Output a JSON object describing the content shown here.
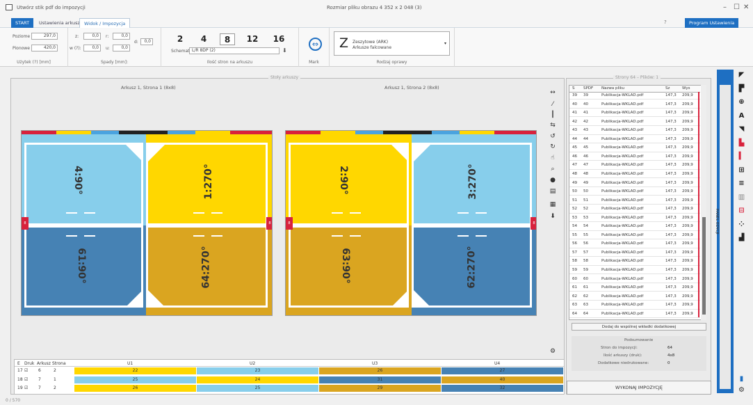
{
  "window": {
    "title": "Utwórz stik pdf do impozycji",
    "image_size_label": "Rozmiar pliku obrazu 4 352 x 2 048 (3)",
    "minimize": "–",
    "maximize": "☐",
    "close": "✕"
  },
  "tabs": [
    {
      "label": "START"
    },
    {
      "label": "Ustawienia arkusza"
    },
    {
      "label": "Widok / Impozycja"
    }
  ],
  "help_icon_label": "?",
  "program_button": "Program Ustawienia",
  "ribbon": {
    "paper": {
      "label_w": "Poziome",
      "val_w": "297,0",
      "label_h": "Pionowe",
      "val_h": "420,0",
      "section": "Użytek (?) [mm]"
    },
    "spady": {
      "z_label": "z:",
      "z_val": "0,0",
      "r_label": "r:",
      "r_val": "0,0",
      "w_label": "w (?):",
      "w_val": "0,0",
      "u_label": "u:",
      "u_val": "0,0",
      "d_label": "d:",
      "d_val": "0,0",
      "section": "Spady [mm]:"
    },
    "counts": {
      "options": [
        "2",
        "4",
        "8",
        "12",
        "16"
      ],
      "selected": "8",
      "schema_label": "Schemat",
      "schema_value": "L/R 8DP (2)",
      "section": "Ilość stron na arkuszu"
    },
    "mark": {
      "section": "Mark"
    },
    "binding": {
      "letter": "Z",
      "line1": "Zeszytowe (ARK)",
      "line2": "Arkusze falcowane",
      "section": "Rodzaj oprawy"
    }
  },
  "workspace": {
    "group_label": "Stoły arkuszy",
    "sheets": [
      {
        "title": "Arkusz 1, Strona 1 (8x8)",
        "pages": [
          {
            "label": "4:90°"
          },
          {
            "label": "1:270°"
          },
          {
            "label": "61:90°"
          },
          {
            "label": "64:270°"
          }
        ]
      },
      {
        "title": "Arkusz 1, Strona 2 (8x8)",
        "pages": [
          {
            "label": "2:90°"
          },
          {
            "label": "3:270°"
          },
          {
            "label": "63:90°"
          },
          {
            "label": "62:270°"
          }
        ]
      }
    ]
  },
  "colors": {
    "accent": "#1e6fc2",
    "yellow": "#ffd700",
    "light_blue": "#87ceeb",
    "steel_blue": "#4682b4",
    "gold": "#daa520",
    "red": "#d8223c"
  },
  "tools": [
    "resize-horizontal-icon",
    "pipette-icon",
    "resize-vertical-icon",
    "swap-icon",
    "rotate-left-icon",
    "rotate-right-icon",
    "hand-icon",
    "zoom-icon",
    "fill-icon",
    "book-icon",
    "calendar-icon",
    "download-icon"
  ],
  "tool_glyphs": [
    "↔",
    "⁄",
    "┃",
    "⇆",
    "↺",
    "↻",
    "☝",
    "⌕",
    "●",
    "▤",
    "▦",
    "⬇"
  ],
  "bottom_table": {
    "headers": [
      "E",
      "Druk",
      "Arkusz",
      "Strona",
      "U1",
      "U2",
      "U3",
      "U4"
    ],
    "rows": [
      {
        "e": "17",
        "druk": "☑",
        "ark": "6",
        "str": "2",
        "u": [
          "22",
          "23",
          "26",
          "27"
        ]
      },
      {
        "e": "18",
        "druk": "☑",
        "ark": "7",
        "str": "1",
        "u": [
          "25",
          "24",
          "31",
          "40"
        ]
      },
      {
        "e": "19",
        "druk": "☑",
        "ark": "7",
        "str": "2",
        "u": [
          "26",
          "25",
          "29",
          "32"
        ]
      }
    ],
    "row_colors": [
      [
        "#ffd700",
        "#87ceeb",
        "#daa520",
        "#4682b4"
      ],
      [
        "#87ceeb",
        "#ffd700",
        "#4682b4",
        "#daa520"
      ],
      [
        "#ffd700",
        "#87ceeb",
        "#daa520",
        "#4682b4"
      ]
    ]
  },
  "right_panel": {
    "group_label": "Strony 64 – Plików: 1",
    "headers": [
      "S",
      "SPDF",
      "Nazwa pliku",
      "Sz",
      "Wys"
    ],
    "rows": [
      [
        "39",
        "39",
        "Publikacja-WKLAD.pdf",
        "147,3",
        "209,9"
      ],
      [
        "40",
        "40",
        "Publikacja-WKLAD.pdf",
        "147,3",
        "209,9"
      ],
      [
        "41",
        "41",
        "Publikacja-WKLAD.pdf",
        "147,3",
        "209,9"
      ],
      [
        "42",
        "42",
        "Publikacja-WKLAD.pdf",
        "147,3",
        "209,9"
      ],
      [
        "43",
        "43",
        "Publikacja-WKLAD.pdf",
        "147,3",
        "209,9"
      ],
      [
        "44",
        "44",
        "Publikacja-WKLAD.pdf",
        "147,3",
        "209,9"
      ],
      [
        "45",
        "45",
        "Publikacja-WKLAD.pdf",
        "147,3",
        "209,9"
      ],
      [
        "46",
        "46",
        "Publikacja-WKLAD.pdf",
        "147,3",
        "209,9"
      ],
      [
        "47",
        "47",
        "Publikacja-WKLAD.pdf",
        "147,3",
        "209,9"
      ],
      [
        "48",
        "48",
        "Publikacja-WKLAD.pdf",
        "147,3",
        "209,9"
      ],
      [
        "49",
        "49",
        "Publikacja-WKLAD.pdf",
        "147,3",
        "209,9"
      ],
      [
        "50",
        "50",
        "Publikacja-WKLAD.pdf",
        "147,3",
        "209,9"
      ],
      [
        "51",
        "51",
        "Publikacja-WKLAD.pdf",
        "147,3",
        "209,9"
      ],
      [
        "52",
        "52",
        "Publikacja-WKLAD.pdf",
        "147,3",
        "209,9"
      ],
      [
        "53",
        "53",
        "Publikacja-WKLAD.pdf",
        "147,3",
        "209,9"
      ],
      [
        "54",
        "54",
        "Publikacja-WKLAD.pdf",
        "147,3",
        "209,9"
      ],
      [
        "55",
        "55",
        "Publikacja-WKLAD.pdf",
        "147,3",
        "209,9"
      ],
      [
        "56",
        "56",
        "Publikacja-WKLAD.pdf",
        "147,3",
        "209,9"
      ],
      [
        "57",
        "57",
        "Publikacja-WKLAD.pdf",
        "147,3",
        "209,9"
      ],
      [
        "58",
        "58",
        "Publikacja-WKLAD.pdf",
        "147,3",
        "209,9"
      ],
      [
        "59",
        "59",
        "Publikacja-WKLAD.pdf",
        "147,3",
        "209,9"
      ],
      [
        "60",
        "60",
        "Publikacja-WKLAD.pdf",
        "147,3",
        "209,9"
      ],
      [
        "61",
        "61",
        "Publikacja-WKLAD.pdf",
        "147,3",
        "209,9"
      ],
      [
        "62",
        "62",
        "Publikacja-WKLAD.pdf",
        "147,3",
        "209,9"
      ],
      [
        "63",
        "63",
        "Publikacja-WKLAD.pdf",
        "147,3",
        "209,9"
      ],
      [
        "64",
        "64",
        "Publikacja-WKLAD.pdf",
        "147,3",
        "209,9"
      ]
    ],
    "add_button": "Dodaj do wspólnej wkładki dodatkowej",
    "summary_title": "Podsumowanie",
    "summary": [
      {
        "label": "Stron do impozycji:",
        "value": "64"
      },
      {
        "label": "Ilość arkuszy (druk):",
        "value": "4x8"
      },
      {
        "label": "Dodatkowe niedrukowane:",
        "value": "0"
      }
    ],
    "generate_button": "WYKONAJ IMPOZYCJĘ"
  },
  "side_vertical_text": "PANEL EDYCJI",
  "side_tools": [
    "layout-top-icon",
    "layout-top-alt-icon",
    "align-center-icon",
    "text-a-icon",
    "flag-icon",
    "pin-icon",
    "column-icon",
    "grid-icon",
    "lines-icon",
    "grid-light-icon",
    "split-icon",
    "dots-icon",
    "marker-icon"
  ],
  "side_tool_glyphs": [
    "◤",
    "▛",
    "⊕",
    "A",
    "◥",
    "▙",
    "▍",
    "⊞",
    "≡",
    "▥",
    "⊟",
    "⁘",
    "▟"
  ],
  "status_text": "0 / 570"
}
